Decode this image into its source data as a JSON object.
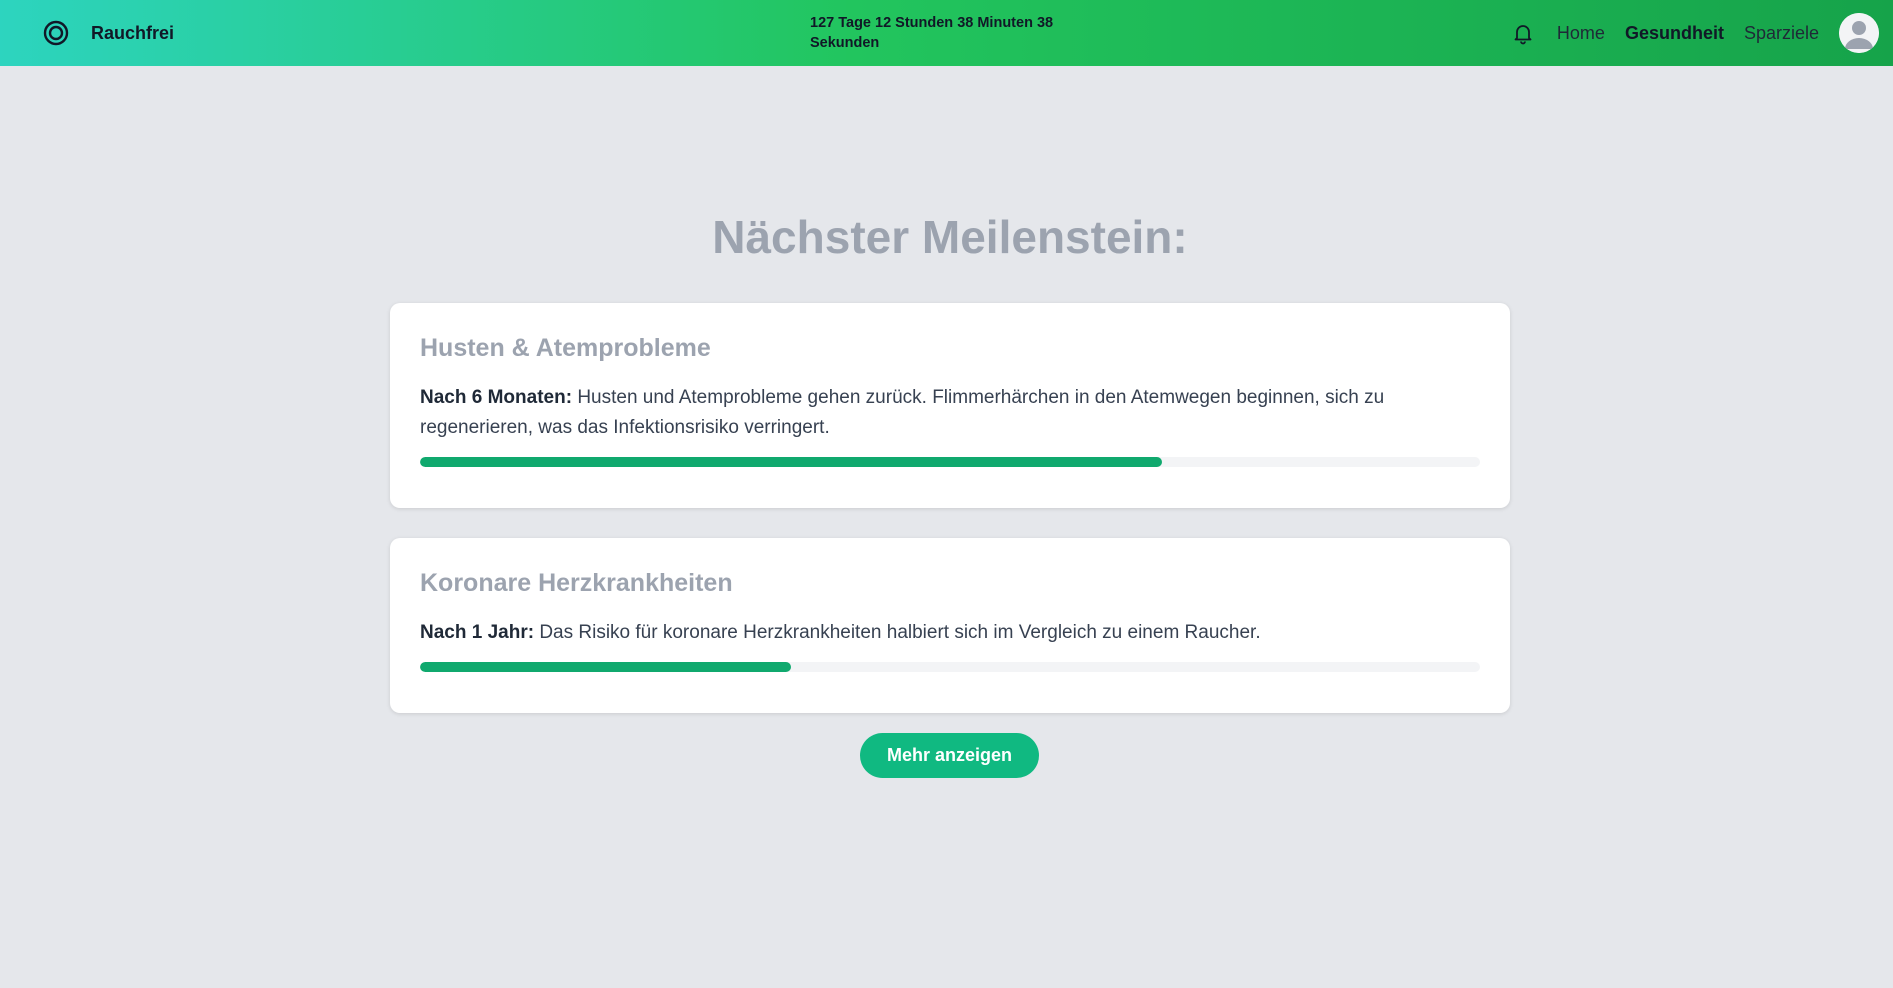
{
  "header": {
    "app_name": "Rauchfrei",
    "timer_text": "127 Tage 12 Stunden 38 Minuten 38 Sekunden",
    "nav": [
      {
        "label": "Home",
        "active": false
      },
      {
        "label": "Gesundheit",
        "active": true
      },
      {
        "label": "Sparziele",
        "active": false
      }
    ],
    "icons": {
      "logo": "target-ring-icon",
      "notifications": "bell-icon",
      "profile": "user-avatar-icon"
    }
  },
  "main": {
    "headline": "Nächster Meilenstein:",
    "milestones": [
      {
        "title": "Husten & Atemprobleme",
        "time_label": "Nach 6 Monaten:",
        "description": "Husten und Atemprobleme gehen zurück. Flimmerhärchen in den Atemwegen beginnen, sich zu regenerieren, was das Infektionsrisiko verringert.",
        "progress": 0.7
      },
      {
        "title": "Koronare Herzkrankheiten",
        "time_label": "Nach 1 Jahr:",
        "description": "Das Risiko für koronare Herzkrankheiten halbiert sich im Vergleich zu einem Raucher.",
        "progress": 0.35
      }
    ],
    "more_button": "Mehr anzeigen"
  },
  "colors": {
    "header_gradient_start": "#2dd4bf",
    "header_gradient_end": "#16a34a",
    "progress_fill": "#10a96e",
    "button": "#10b981",
    "background": "#e5e7eb"
  }
}
